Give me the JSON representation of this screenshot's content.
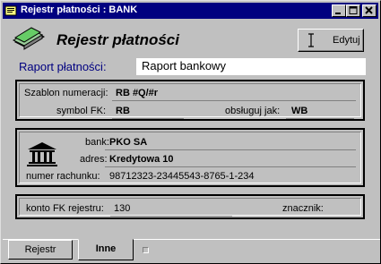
{
  "window": {
    "title": "Rejestr płatności : BANK"
  },
  "header": {
    "heading": "Rejestr płatności",
    "edit_label": "Edytuj"
  },
  "raport": {
    "label": "Raport płatności:",
    "value": "Raport bankowy"
  },
  "numbering": {
    "template_label": "Szablon numeracji:",
    "template_value": "RB #Q/#r",
    "symbol_label": "symbol FK:",
    "symbol_value": "RB",
    "handle_label": "obsługuj jak:",
    "handle_value": "WB"
  },
  "bank": {
    "bank_label": "bank:",
    "bank_value": "PKO SA",
    "address_label": "adres:",
    "address_value": "Kredytowa 10",
    "account_label": "numer rachunku:",
    "account_value": "98712323-23445543-8765-1-234"
  },
  "register": {
    "account_label": "konto FK rejestru:",
    "account_value": "130",
    "marker_label": "znacznik:",
    "marker_value": ""
  },
  "tabs": [
    {
      "label": "Rejestr",
      "active": false
    },
    {
      "label": "Inne",
      "active": true
    }
  ],
  "colors": {
    "titlebar": "#000080",
    "label_accent": "#000080",
    "face": "#c0c0c0"
  }
}
